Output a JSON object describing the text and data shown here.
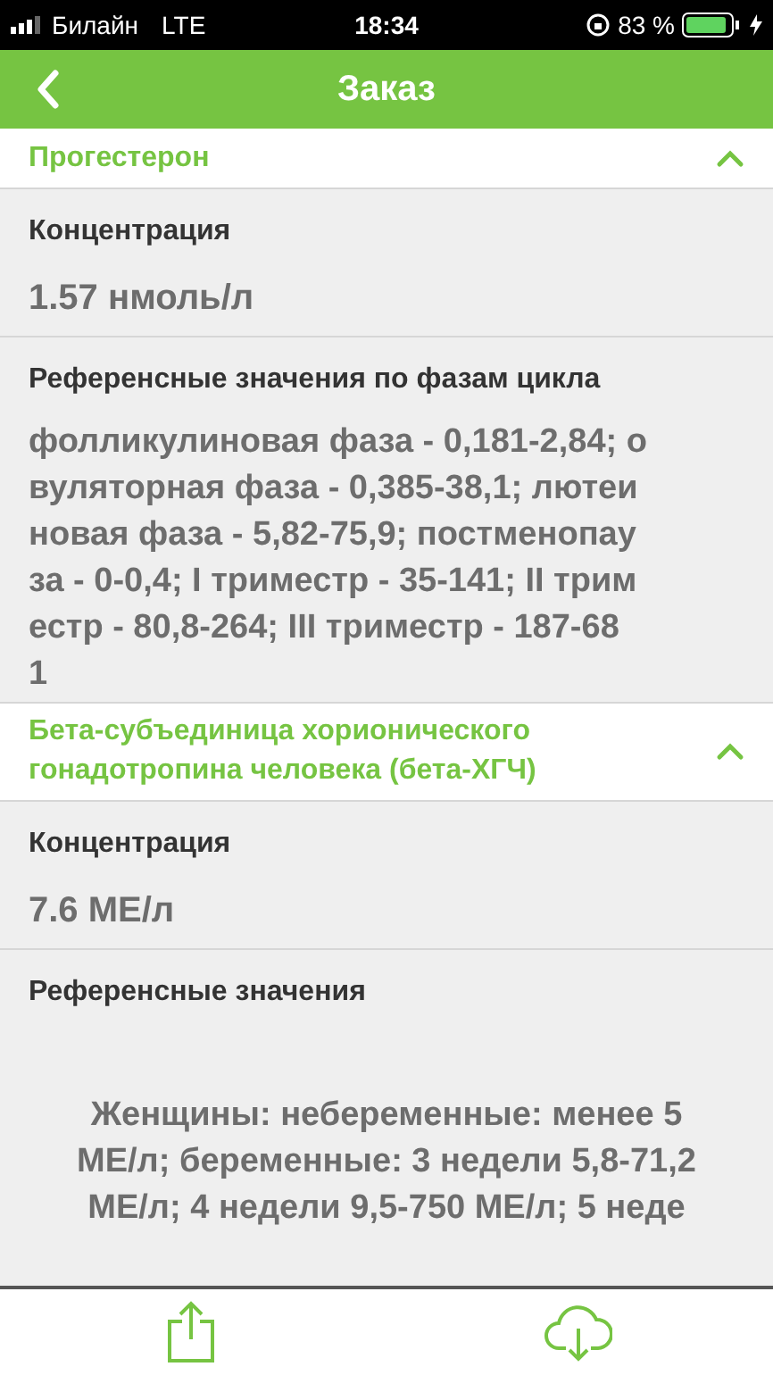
{
  "status_bar": {
    "carrier": "Билайн",
    "network": "LTE",
    "time": "18:34",
    "battery": "83 %"
  },
  "header": {
    "title": "Заказ"
  },
  "sections": [
    {
      "title": [
        "Прогестерон"
      ],
      "expanded": true,
      "fields": [
        {
          "kind": "value",
          "label": "Концентрация",
          "lines": [
            "1.57 нмоль/л"
          ]
        },
        {
          "kind": "reference",
          "label": "Референсные значения по фазам цикла",
          "lines": [
            "фолликулиновая фаза - 0,181-2,84; о",
            "вуляторная фаза - 0,385-38,1; лютеи",
            "новая фаза - 5,82-75,9; постменопау",
            "за - 0-0,4; I триместр - 35-141; II трим",
            "естр - 80,8-264; III триместр - 187-68",
            "1"
          ]
        }
      ]
    },
    {
      "title": [
        "Бета-субъединица хорионического",
        "гонадотропина человека (бета-ХГЧ)"
      ],
      "expanded": true,
      "fields": [
        {
          "kind": "value",
          "label": "Концентрация",
          "lines": [
            "7.6 МЕ/л"
          ]
        },
        {
          "kind": "reference_centered",
          "label": "Референсные значения",
          "lines": [
            "Женщины: небеременные: менее 5",
            "МЕ/л; беременные: 3 недели 5,8-71,2",
            "МЕ/л; 4 недели 9,5-750 МЕ/л; 5 неде"
          ]
        }
      ]
    }
  ]
}
